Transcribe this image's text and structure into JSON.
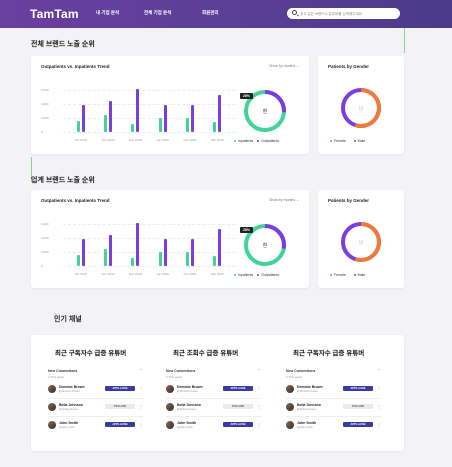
{
  "header": {
    "logo": "TamTam",
    "nav": [
      "내 기업 분석",
      "전체 기업 분석",
      "회원관리"
    ],
    "search_placeholder": "찾고 싶은 브랜드나 유튜버를 입력해주세요."
  },
  "sections": [
    {
      "title": "전체 브랜드 노출 순위",
      "trend_title": "Outpatients vs. Inpatients Trend",
      "dropdown": "Show by months",
      "y_ticks": [
        "6,000",
        "4,000",
        "2,000",
        "0"
      ],
      "badge": "26%",
      "donut_center": "환",
      "legend": [
        "Inpatients",
        "Outpatients"
      ],
      "gender_title": "Patients by Gender",
      "gender_center": "남",
      "gender_legend": [
        "Female",
        "Male"
      ]
    },
    {
      "title": "업계 브랜드 노출 순위",
      "trend_title": "Outpatients vs. Inpatients Trend",
      "dropdown": "Show by months",
      "y_ticks": [
        "6,000",
        "4,000",
        "2,000",
        "0"
      ],
      "badge": "28%",
      "donut_center": "환",
      "legend": [
        "Inpatients",
        "Outpatients"
      ],
      "gender_title": "Patients by Gender",
      "gender_center": "남",
      "gender_legend": [
        "Female",
        "Male"
      ]
    }
  ],
  "chart_data": [
    {
      "type": "bar",
      "categories": [
        "Oct 2019",
        "Nov 2019",
        "Dec 2019",
        "Jan 2020",
        "Feb 2020",
        "Mar 2020"
      ],
      "series": [
        {
          "name": "Inpatients",
          "values": [
            1600,
            2500,
            1100,
            2000,
            2000,
            1400
          ]
        },
        {
          "name": "Outpatients",
          "values": [
            3900,
            4500,
            6100,
            3900,
            3900,
            5300
          ]
        }
      ],
      "ylim": [
        0,
        6000
      ],
      "legend": "bottom-right",
      "colors": {
        "Inpatients": "#40d39a",
        "Outpatients": "#7a3ee0"
      }
    },
    {
      "type": "bar",
      "categories": [
        "Oct 2019",
        "Nov 2019",
        "Dec 2019",
        "Jan 2020",
        "Feb 2020",
        "Mar 2020"
      ],
      "series": [
        {
          "name": "Inpatients",
          "values": [
            1600,
            2500,
            1100,
            2000,
            2000,
            1400
          ]
        },
        {
          "name": "Outpatients",
          "values": [
            3900,
            4500,
            6100,
            3900,
            3900,
            5300
          ]
        }
      ],
      "ylim": [
        0,
        6000
      ],
      "legend": "bottom-right",
      "colors": {
        "Inpatients": "#40d39a",
        "Outpatients": "#7a3ee0"
      }
    }
  ],
  "donuts": {
    "patients_share": [
      0.26,
      0.28
    ],
    "gender_female_share": 0.55,
    "colors": {
      "primary": "#7a3ee0",
      "secondary": "#40d39a",
      "female": "#f07a3a",
      "male": "#7a3ee0"
    }
  },
  "popular": {
    "title": "인기 채널",
    "panels": [
      {
        "title": "최근 구독자수 급증 유튜버",
        "head": "New Connections",
        "sub": "2 This week"
      },
      {
        "title": "최근 조회수 급증 유튜버",
        "head": "New Connections",
        "sub": "2 This week"
      },
      {
        "title": "최근 구독자수 급증 유튜버",
        "head": "New Connections",
        "sub": "2 This week"
      }
    ],
    "rows": [
      {
        "name": "Dominic Brown",
        "handle": "@dominic.brown",
        "action": "APPLAUSE",
        "style": "primary"
      },
      {
        "name": "Bella Johnson",
        "handle": "@bella.johnson",
        "action": "FOLLOW",
        "style": "secondary"
      },
      {
        "name": "John Smith",
        "handle": "@john.smith",
        "action": "APPLAUSE",
        "style": "primary"
      }
    ]
  }
}
